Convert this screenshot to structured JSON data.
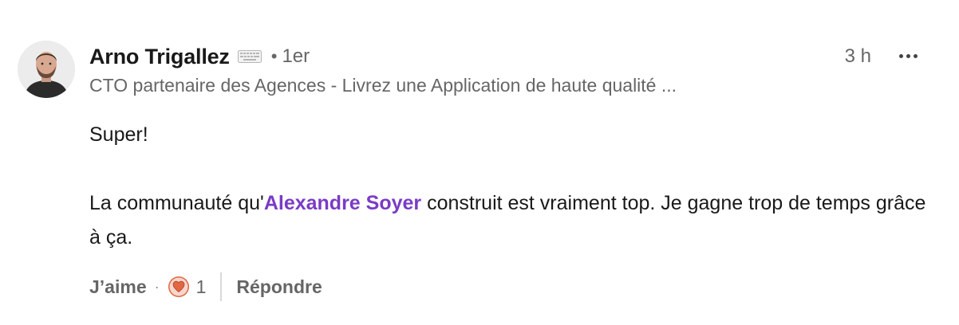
{
  "author": {
    "name": "Arno Trigallez",
    "degree": "1er",
    "separator": "•",
    "headline": "CTO partenaire des Agences - Livrez une Application de haute qualité ..."
  },
  "meta": {
    "timestamp": "3 h"
  },
  "comment": {
    "line1": "Super!",
    "line2_before": "La communauté qu'",
    "mention": "Alexandre Soyer",
    "line2_after": " construit est vraiment top. Je gagne trop de temps grâce à ça."
  },
  "actions": {
    "like_label": "J’aime",
    "dot": "·",
    "reaction_count": "1",
    "reply_label": "Répondre"
  },
  "icons": {
    "badge": "keyboard-icon",
    "more": "more-horizontal-icon",
    "reaction": "heart-reaction-icon"
  },
  "colors": {
    "mention": "#7a3bc6",
    "reaction": "#e16745",
    "muted_text": "#666666"
  }
}
